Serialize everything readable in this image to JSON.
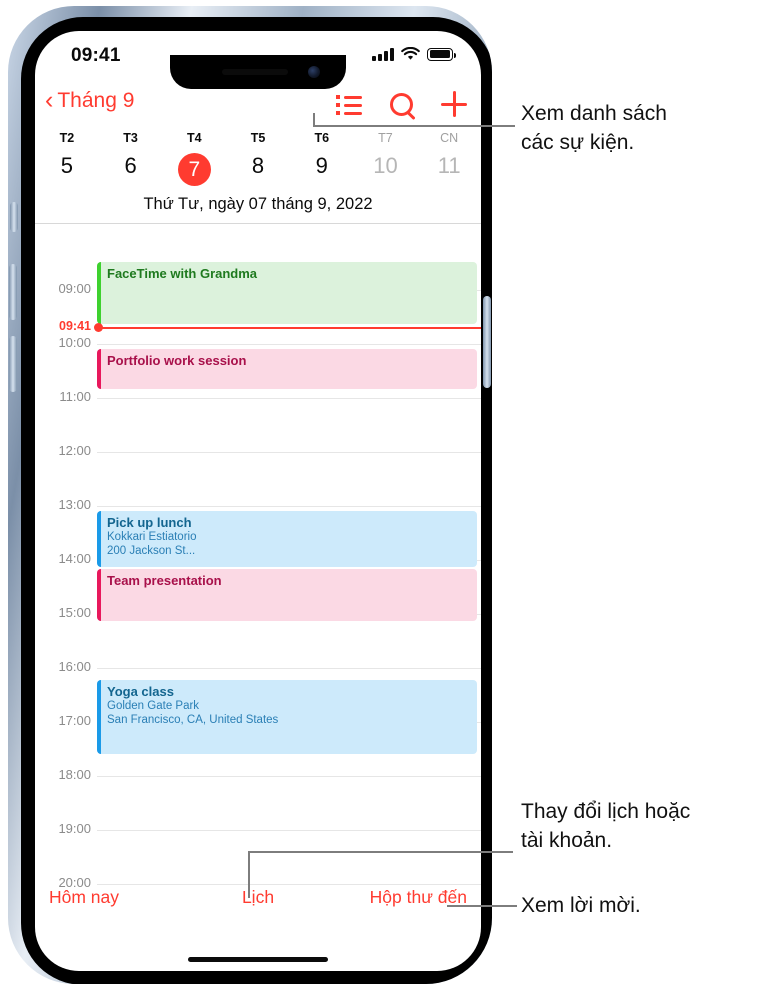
{
  "status_bar": {
    "time": "09:41",
    "signal_icon": "cellular-signal-icon",
    "wifi_icon": "wifi-icon",
    "battery_icon": "battery-icon"
  },
  "nav": {
    "back_label": "Tháng 9",
    "back_chevron": "‹",
    "list_icon": "list-view-icon",
    "search_icon": "search-icon",
    "add_icon": "plus-icon"
  },
  "week": {
    "days": [
      {
        "dow": "T2",
        "num": "5",
        "dim": false,
        "selected": false
      },
      {
        "dow": "T3",
        "num": "6",
        "dim": false,
        "selected": false
      },
      {
        "dow": "T4",
        "num": "7",
        "dim": false,
        "selected": true
      },
      {
        "dow": "T5",
        "num": "8",
        "dim": false,
        "selected": false
      },
      {
        "dow": "T6",
        "num": "9",
        "dim": false,
        "selected": false
      },
      {
        "dow": "T7",
        "num": "10",
        "dim": true,
        "selected": false
      },
      {
        "dow": "CN",
        "num": "11",
        "dim": true,
        "selected": false
      }
    ],
    "selected_color": "#ff3b30"
  },
  "day_title": "Thứ Tư, ngày 07 tháng 9, 2022",
  "timeline": {
    "hours": [
      "09:00",
      "10:00",
      "11:00",
      "12:00",
      "13:00",
      "14:00",
      "15:00",
      "16:00",
      "17:00",
      "18:00",
      "19:00",
      "20:00"
    ],
    "now_marker": {
      "label": "09:41",
      "color": "#ff3b30"
    },
    "events": [
      {
        "title": "FaceTime with Grandma",
        "sub1": "",
        "sub2": "",
        "color": "green"
      },
      {
        "title": "Portfolio work session",
        "sub1": "",
        "sub2": "",
        "color": "pink"
      },
      {
        "title": "Pick up lunch",
        "sub1": "Kokkari Estiatorio",
        "sub2": "200 Jackson St...",
        "color": "blue"
      },
      {
        "title": "Team presentation",
        "sub1": "",
        "sub2": "",
        "color": "pink"
      },
      {
        "title": "Yoga class",
        "sub1": "Golden Gate Park",
        "sub2": "San Francisco, CA, United States",
        "color": "blue"
      }
    ]
  },
  "toolbar": {
    "today_label": "Hôm nay",
    "calendars_label": "Lịch",
    "inbox_label": "Hộp thư đến"
  },
  "callouts": {
    "list_view": "Xem danh sách\ncác sự kiện.",
    "list_view_line1": "Xem danh sách",
    "list_view_line2": "các sự kiện.",
    "calendars_line1": "Thay đổi lịch hoặc",
    "calendars_line2": "tài khoản.",
    "inbox": "Xem lời mời."
  }
}
